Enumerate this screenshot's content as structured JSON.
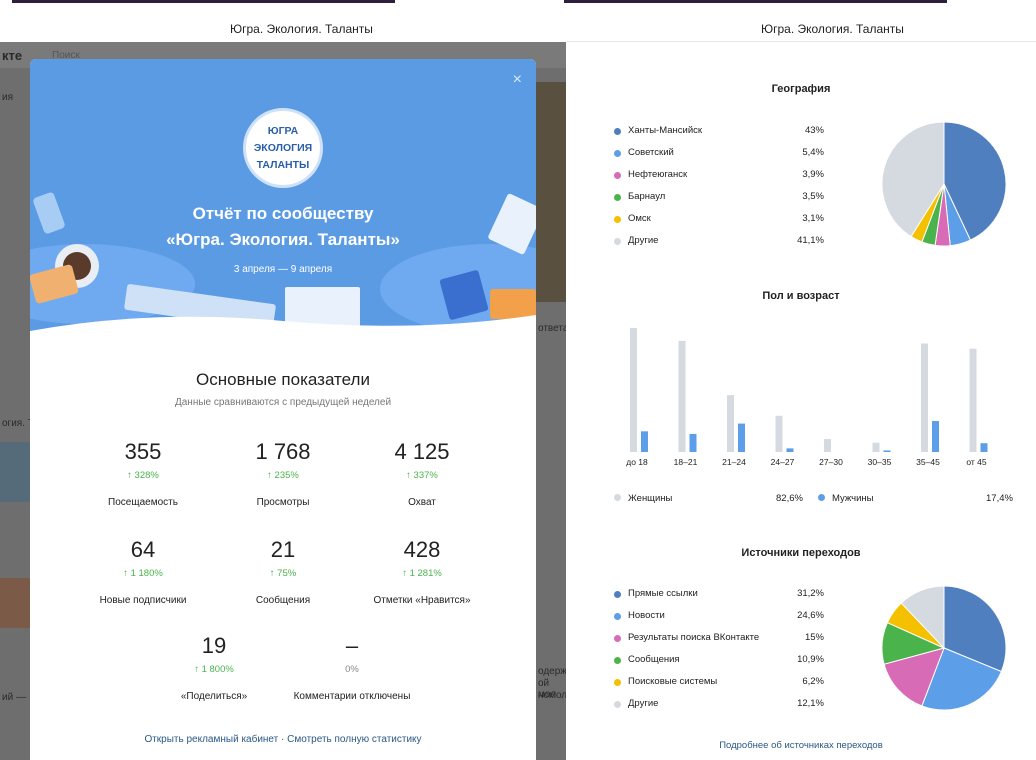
{
  "left_caption": "Югра. Экология. Таланты",
  "right_caption": "Югра. Экология. Таланты",
  "background": {
    "brand": "кте",
    "search_placeholder": "Поиск",
    "answers_text": "ответа",
    "fragment_1": "ия",
    "fragment_2": "огия. Т",
    "fragment_3": "ий —",
    "fragment_4": "одерж",
    "fragment_5": "ой мол",
    "fragment_6": "номол"
  },
  "report": {
    "logo_lines": [
      "ЮГРА",
      "ЭКОЛОГИЯ",
      "ТАЛАНТЫ"
    ],
    "close_icon": "×",
    "title_line1": "Отчёт по сообществу",
    "title_line2": "«Югра. Экология. Таланты»",
    "date_range": "3 апреля — 9 апреля",
    "section_title": "Основные показатели",
    "section_subtitle": "Данные сравниваются с предыдущей неделей",
    "metrics": [
      {
        "value": "355",
        "delta": "↑ 328%",
        "label": "Посещаемость"
      },
      {
        "value": "1 768",
        "delta": "↑ 235%",
        "label": "Просмотры"
      },
      {
        "value": "4 125",
        "delta": "↑ 337%",
        "label": "Охват"
      },
      {
        "value": "64",
        "delta": "↑ 1 180%",
        "label": "Новые подписчики"
      },
      {
        "value": "21",
        "delta": "↑ 75%",
        "label": "Сообщения"
      },
      {
        "value": "428",
        "delta": "↑ 1 281%",
        "label": "Отметки «Нравится»"
      },
      {
        "value": "19",
        "delta": "↑ 1 800%",
        "label": "«Поделиться»"
      },
      {
        "value": "–",
        "delta": "0%",
        "label": "Комментарии отключены"
      }
    ],
    "link_ads": "Открыть рекламный кабинет",
    "link_sep": " · ",
    "link_stats": "Смотреть полную статистику"
  },
  "colors": {
    "hero_blue": "#5b9be4",
    "accent_green": "#4bb34b",
    "link_blue": "#2a5885"
  },
  "stats": {
    "geo_title": "География",
    "age_title": "Пол и возраст",
    "sources_title": "Источники переходов",
    "more_link": "Подробнее об источниках переходов",
    "gender": {
      "women_label": "Женщины",
      "women_value": "82,6%",
      "men_label": "Мужчины",
      "men_value": "17,4%"
    }
  },
  "chart_data": [
    {
      "type": "pie",
      "title": "География",
      "labels": [
        "Ханты-Мансийск",
        "Советский",
        "Нефтеюганск",
        "Барнаул",
        "Омск",
        "Другие"
      ],
      "display": [
        "43%",
        "5,4%",
        "3,9%",
        "3,5%",
        "3,1%",
        "41,1%"
      ],
      "values": [
        43,
        5.4,
        3.9,
        3.5,
        3.1,
        41.1
      ],
      "colors": [
        "#4f7fbf",
        "#5c9ee8",
        "#d86bb5",
        "#4bb34b",
        "#f5c000",
        "#d5d9e0"
      ]
    },
    {
      "type": "bar",
      "title": "Пол и возраст",
      "categories": [
        "до 18",
        "18–21",
        "21–24",
        "24–27",
        "27–30",
        "30–35",
        "35–45",
        "от 45"
      ],
      "series": [
        {
          "name": "Женщины",
          "values": [
            24,
            21.5,
            11,
            7,
            2.5,
            1.8,
            21,
            20
          ],
          "color": "#d5d9e0"
        },
        {
          "name": "Мужчины",
          "values": [
            4,
            3.5,
            5.5,
            0.7,
            0,
            0.3,
            6,
            1.7
          ],
          "color": "#5c9ee8"
        }
      ]
    },
    {
      "type": "pie",
      "title": "Источники переходов",
      "labels": [
        "Прямые ссылки",
        "Новости",
        "Результаты поиска ВКонтакте",
        "Сообщения",
        "Поисковые системы",
        "Другие"
      ],
      "display": [
        "31,2%",
        "24,6%",
        "15%",
        "10,9%",
        "6,2%",
        "12,1%"
      ],
      "values": [
        31.2,
        24.6,
        15,
        10.9,
        6.2,
        12.1
      ],
      "colors": [
        "#4f7fbf",
        "#5c9ee8",
        "#d86bb5",
        "#4bb34b",
        "#f5c000",
        "#d5d9e0"
      ]
    }
  ]
}
